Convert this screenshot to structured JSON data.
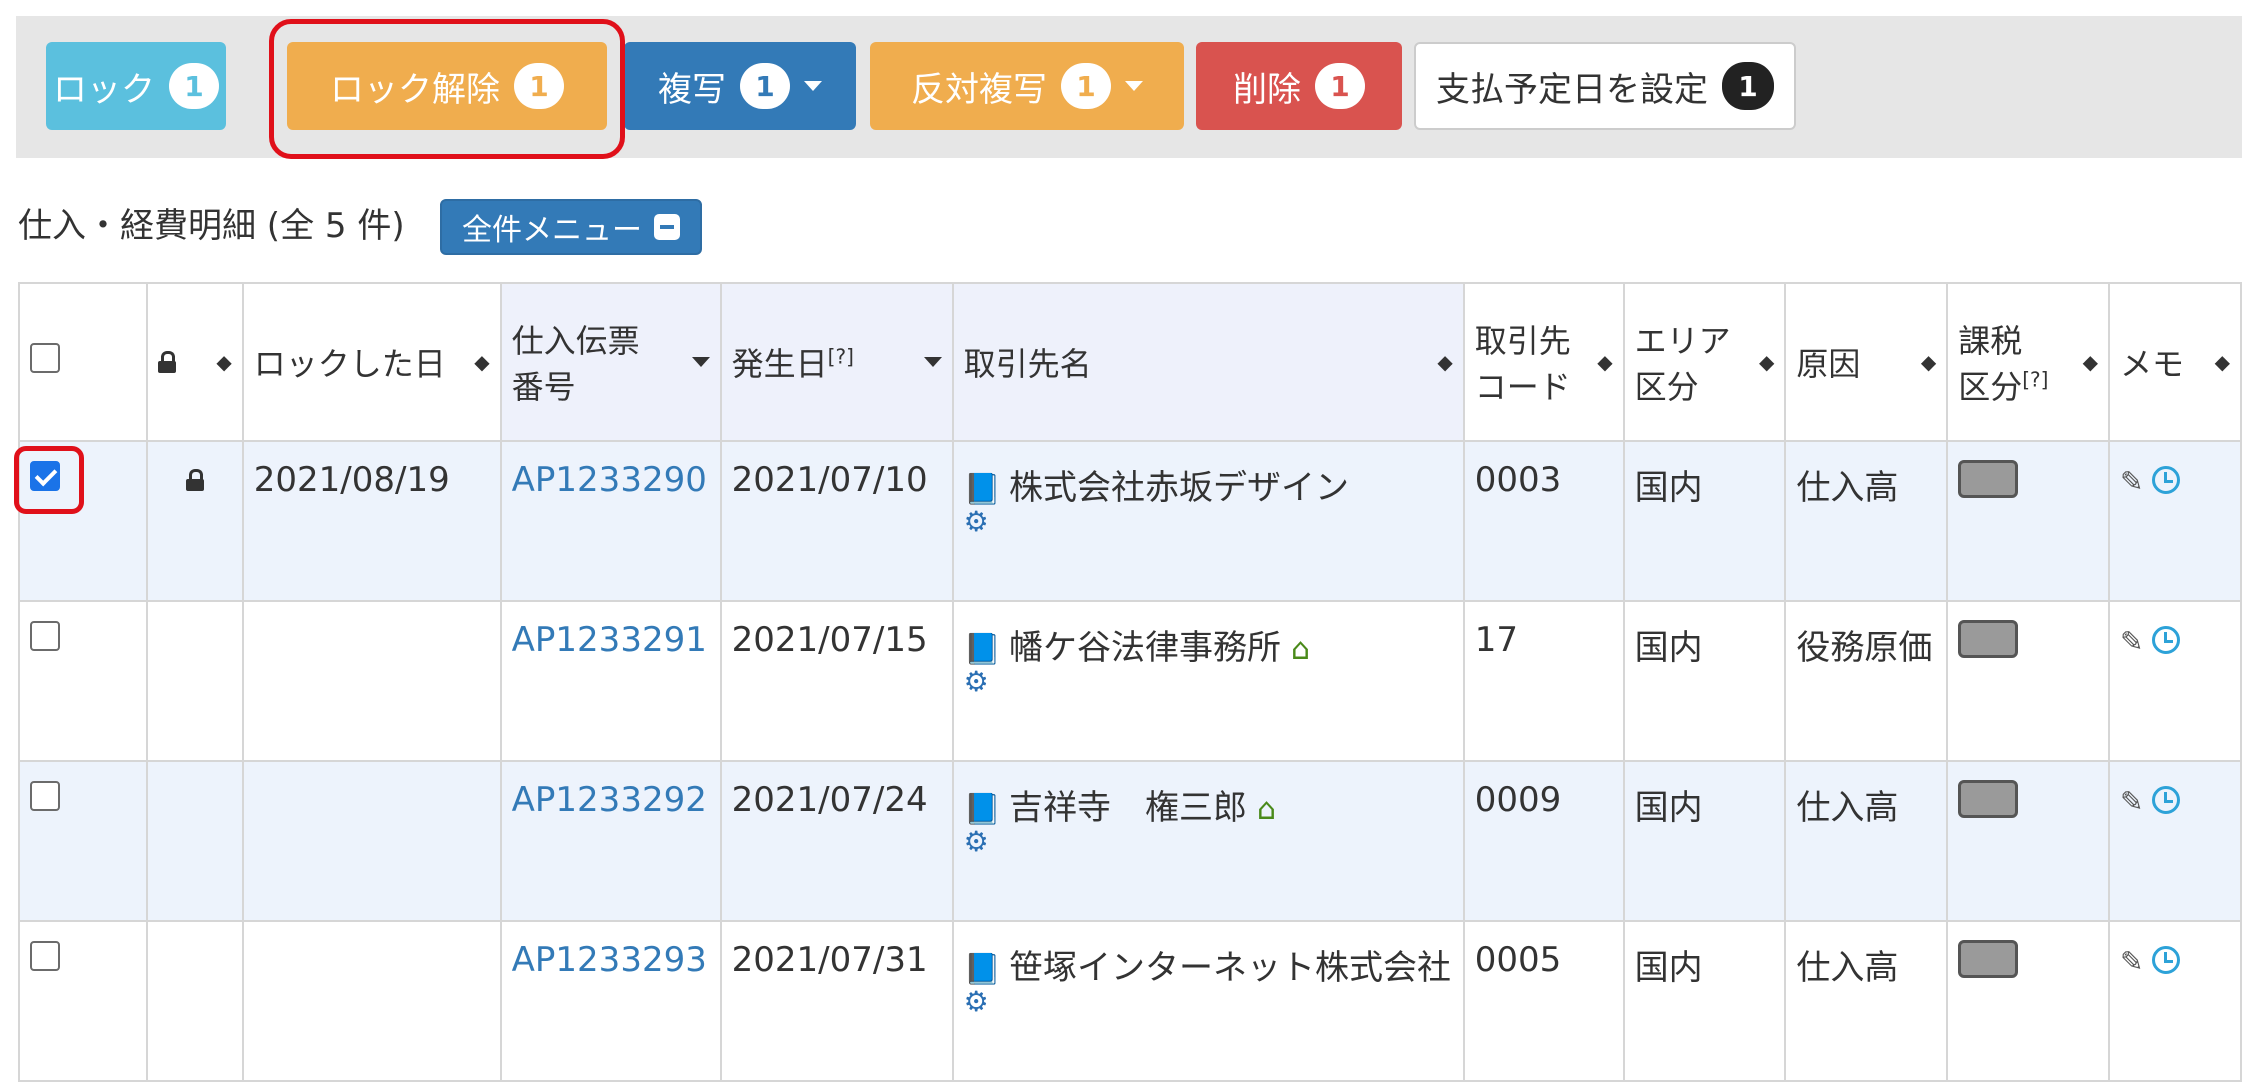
{
  "toolbar": {
    "buttons": [
      {
        "label": "ロック",
        "badge": "1",
        "color": "#5bc0de"
      },
      {
        "label": "ロック解除",
        "badge": "1",
        "color": "#f0ad4e"
      },
      {
        "label": "複写",
        "badge": "1",
        "color": "#337ab7"
      },
      {
        "label": "反対複写",
        "badge": "1",
        "color": "#f0ad4e"
      },
      {
        "label": "削除",
        "badge": "1",
        "color": "#d9534f"
      },
      {
        "label": "支払予定日を設定",
        "badge": "1",
        "color": "#ffffff"
      }
    ]
  },
  "section": {
    "title": "仕入・経費明細 (全 5 件)",
    "menu_label": "全件メニュー"
  },
  "table": {
    "headers": {
      "lock_date": "ロックした日",
      "slip_no_1": "仕入伝票",
      "slip_no_2": "番号",
      "date": "発生日",
      "date_note": "[?]",
      "partner": "取引先名",
      "code_1": "取引先",
      "code_2": "コード",
      "area_1": "エリア",
      "area_2": "区分",
      "cause": "原因",
      "tax_1": "課税",
      "tax_2": "区分",
      "tax_note": "[?]",
      "memo": "メモ"
    },
    "rows": [
      {
        "checked": true,
        "locked": true,
        "lock_date": "2021/08/19",
        "slip_no": "AP1233290",
        "date": "2021/07/10",
        "partner": "株式会社赤坂デザイン",
        "home": false,
        "code": "0003",
        "area": "国内",
        "cause": "仕入高"
      },
      {
        "checked": false,
        "locked": false,
        "lock_date": "",
        "slip_no": "AP1233291",
        "date": "2021/07/15",
        "partner": "幡ケ谷法律事務所",
        "home": true,
        "code": "17",
        "area": "国内",
        "cause": "役務原価"
      },
      {
        "checked": false,
        "locked": false,
        "lock_date": "",
        "slip_no": "AP1233292",
        "date": "2021/07/24",
        "partner": "吉祥寺　権三郎",
        "home": true,
        "code": "0009",
        "area": "国内",
        "cause": "仕入高"
      },
      {
        "checked": false,
        "locked": false,
        "lock_date": "",
        "slip_no": "AP1233293",
        "date": "2021/07/31",
        "partner": "笹塚インターネット株式会社",
        "home": false,
        "code": "0005",
        "area": "国内",
        "cause": "仕入高"
      }
    ]
  },
  "icons": {
    "sort": "sort-icon",
    "lock": "lock-icon",
    "book": "book-icon",
    "gear": "gear-icon",
    "home": "home-icon",
    "edit": "edit-icon",
    "clock": "clock-icon"
  }
}
